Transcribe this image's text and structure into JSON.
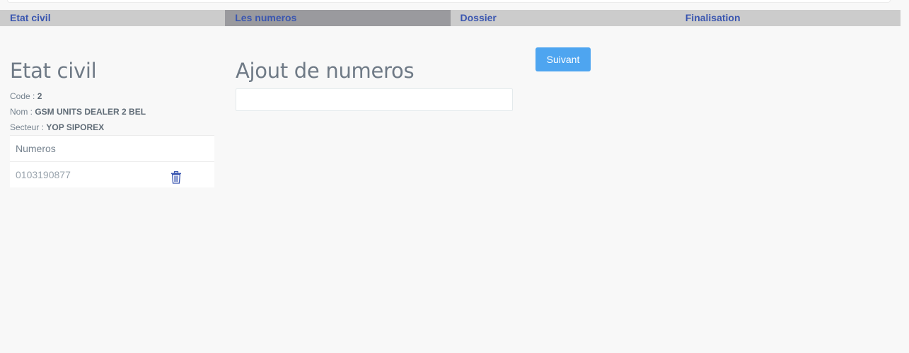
{
  "steps": [
    {
      "label": "Etat civil",
      "active": false
    },
    {
      "label": "Les numeros",
      "active": true
    },
    {
      "label": "Dossier",
      "active": false
    },
    {
      "label": "Finalisation",
      "active": false
    }
  ],
  "etat_civil": {
    "title": "Etat civil",
    "code_label": "Code : ",
    "code_value": "2",
    "nom_label": "Nom : ",
    "nom_value": "GSM UNITS DEALER 2 BEL",
    "secteur_label": "Secteur : ",
    "secteur_value": "YOP SIPOREX"
  },
  "numeros_table": {
    "header": "Numeros",
    "rows": [
      {
        "number": "0103190877",
        "action_icon": "trash-icon"
      }
    ]
  },
  "ajout": {
    "title": "Ajout de numeros",
    "input_value": "",
    "input_placeholder": ""
  },
  "actions": {
    "next_label": "Suivant"
  },
  "colors": {
    "accent_button": "#4ea5f0",
    "step_link": "#3a56b0",
    "step_bg": "#cccccc",
    "step_active_bg": "#9a9a9e"
  }
}
